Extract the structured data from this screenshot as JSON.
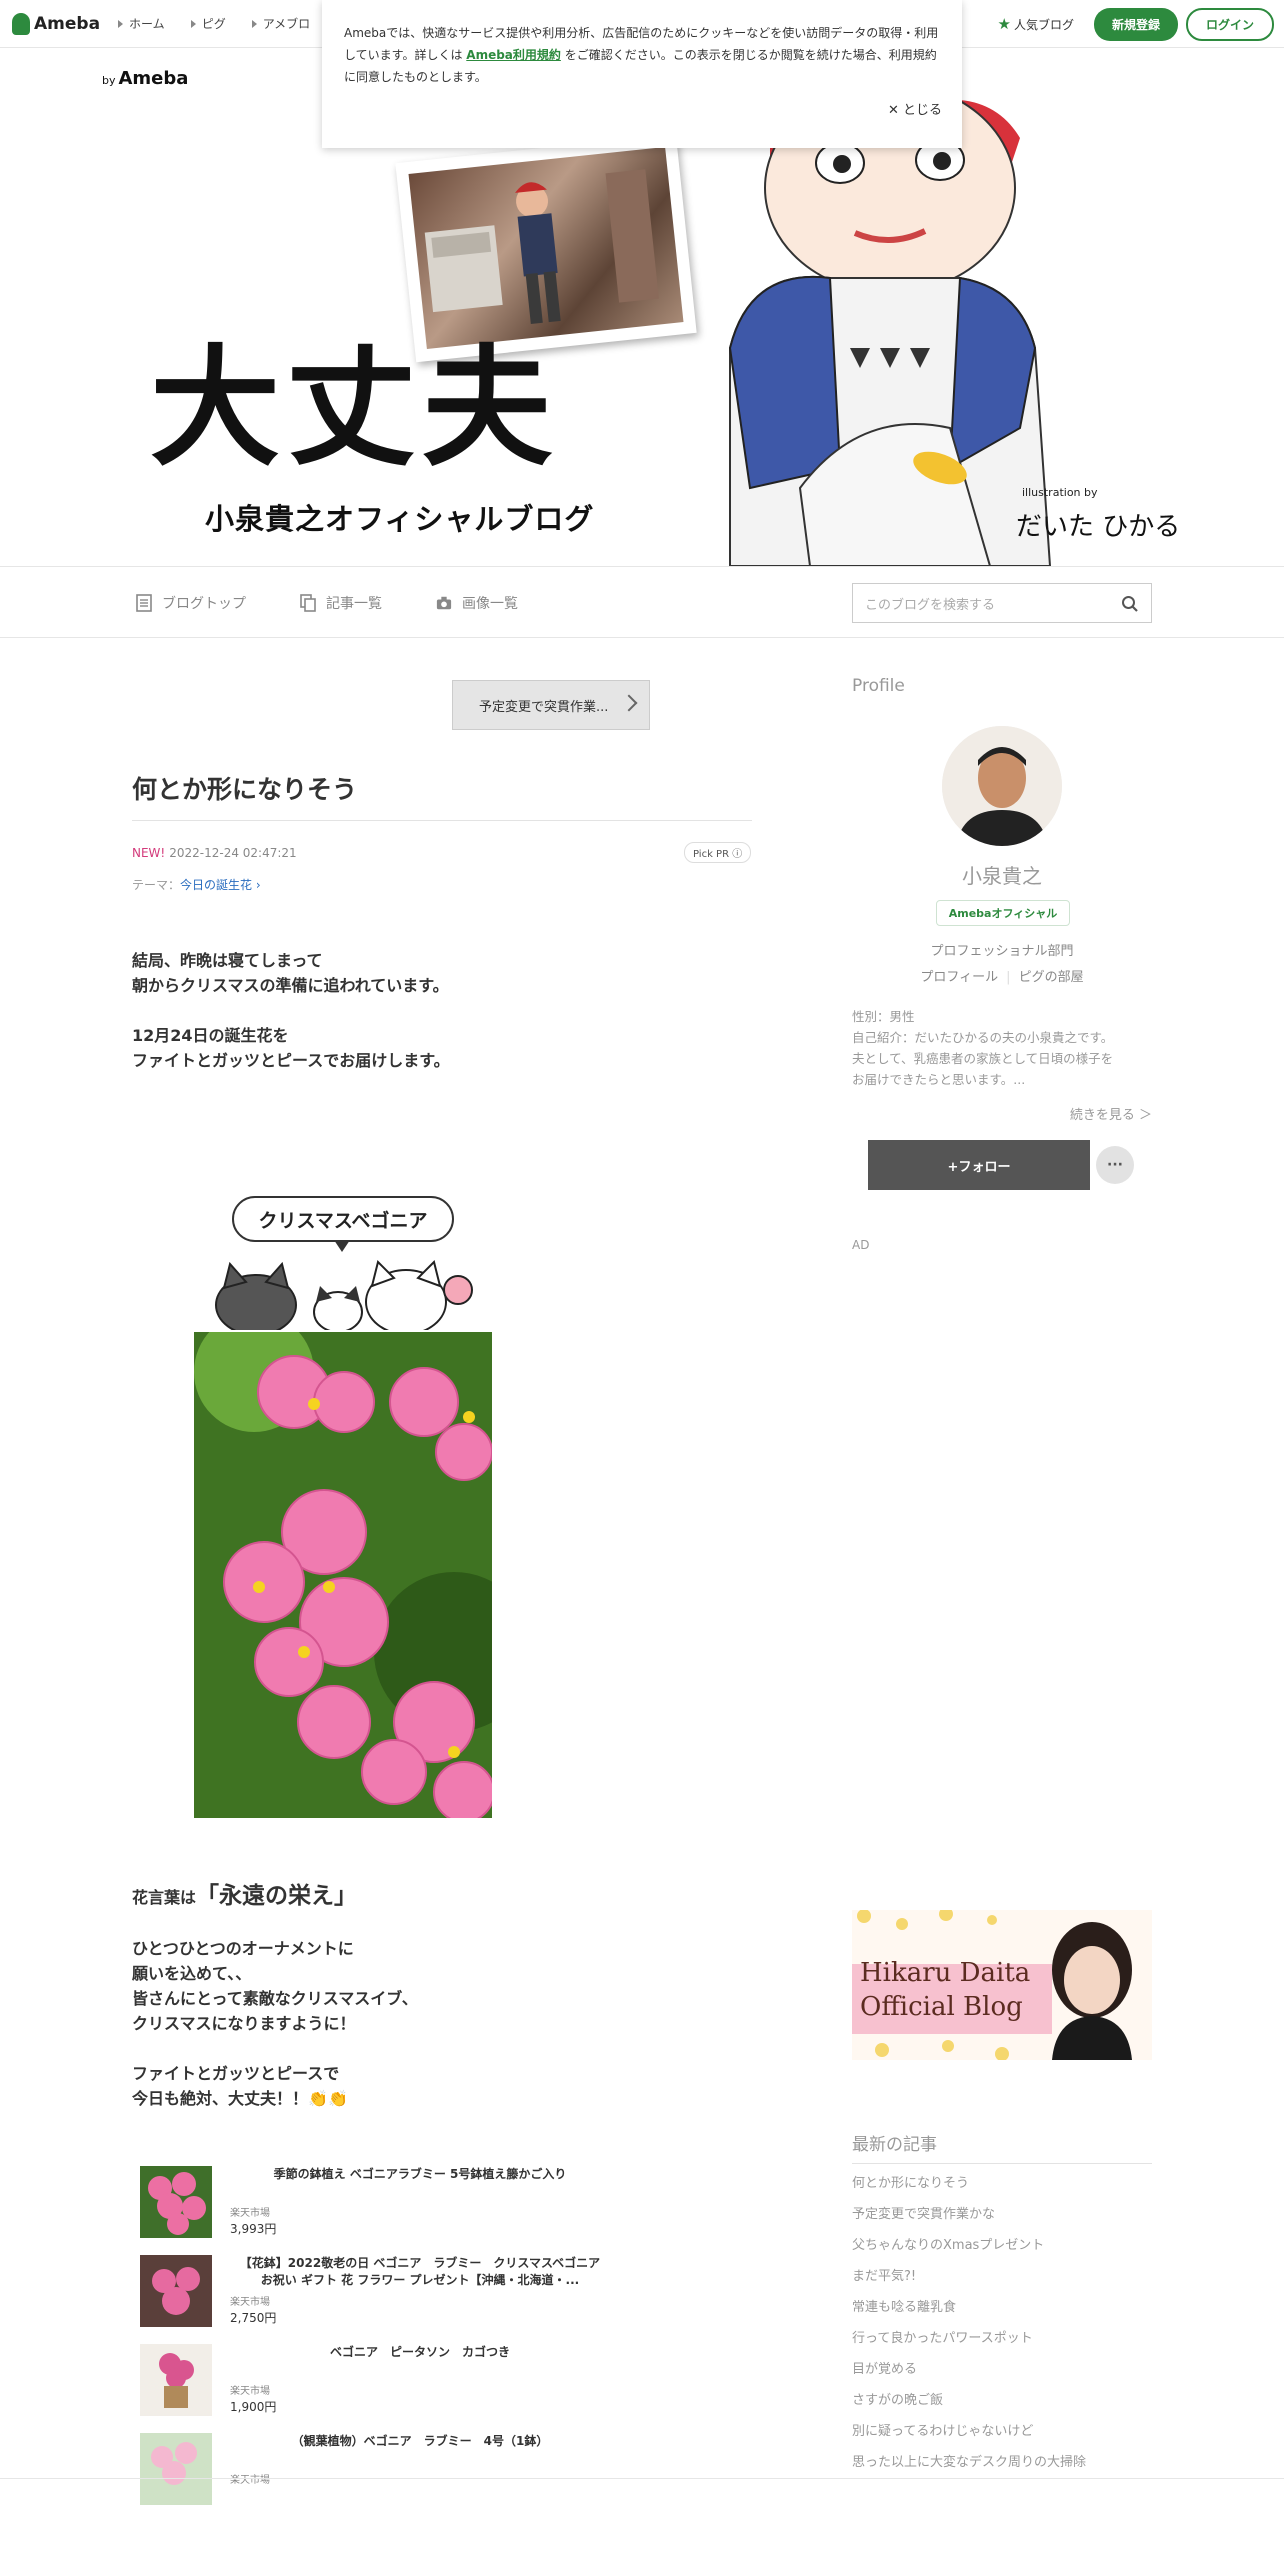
{
  "topnav": {
    "brand": "Ameba",
    "links": [
      "ホーム",
      "ピグ",
      "アメブロ"
    ],
    "popular": "人気ブログ",
    "signup": "新規登録",
    "login": "ログイン"
  },
  "cookie": {
    "text_before": "Amebaでは、快適なサービス提供や利用分析、広告配信のためにクッキーなどを使い訪問データの取得・利用しています。詳しくは",
    "link": "Ameba利用規約",
    "text_after": "をご確認ください。この表示を閉じるか閲覧を続けた場合、利用規約に同意したものとします。",
    "close": "とじる"
  },
  "header": {
    "by": "by",
    "by_brand": "Ameba",
    "title": "大丈夫",
    "subtitle": "小泉貴之オフィシャルブログ",
    "illustration_by": "illustration by",
    "illustrator": "だいた ひかる"
  },
  "blognav": {
    "items": [
      "ブログトップ",
      "記事一覧",
      "画像一覧"
    ],
    "search_placeholder": "このブログを検索する"
  },
  "entry": {
    "prev_link": "予定変更で突貫作業...",
    "title": "何とか形になりそう",
    "new": "NEW!",
    "date": "2022-12-24 02:47:21",
    "pick_pr": "Pick PR",
    "theme_label": "テーマ：",
    "theme": "今日の誕生花",
    "para1_line1": "結局、昨晩は寝てしまって",
    "para1_line2": "朝からクリスマスの準備に追われています。",
    "para2_line1": "12月24日の誕生花を",
    "para2_line2": "ファイトとガッツとピースでお届けします。",
    "bubble": "クリスマスベゴニア",
    "kotoba_prefix": "花言葉は",
    "kotoba": "「永遠の栄え」",
    "para3_line1": "ひとつひとつのオーナメントに",
    "para3_line2": "願いを込めて、、",
    "para3_line3": "皆さんにとって素敵なクリスマスイブ、",
    "para3_line4": "クリスマスになりますように！",
    "para4_line1": "ファイトとガッツとピースで",
    "para4_line2": "今日も絶対、大丈夫！！"
  },
  "products": [
    {
      "name": "季節の鉢植え ベゴニアラブミー 5号鉢植え籐かご入り",
      "shop": "楽天市場",
      "price": "3,993円"
    },
    {
      "name": "【花鉢】2022敬老の日 ベゴニア　ラブミー　クリスマスベゴニア　お祝い ギフト 花 フラワー プレゼント【沖縄・北海道・...",
      "shop": "楽天市場",
      "price": "2,750円"
    },
    {
      "name": "ベゴニア　ピータソン　カゴつき",
      "shop": "楽天市場",
      "price": "1,900円"
    },
    {
      "name": "（観葉植物）ベゴニア　ラブミー　4号（1鉢）",
      "shop": "楽天市場",
      "price": ""
    }
  ],
  "sidebar": {
    "profile_heading": "Profile",
    "name": "小泉貴之",
    "official": "Amebaオフィシャル",
    "dept": "プロフェッショナル部門",
    "link1": "プロフィール",
    "link2": "ピグの部屋",
    "bio_line1": "性別：男性",
    "bio_line2": "自己紹介：だいたひかるの夫の小泉貴之です。",
    "bio_line3": "夫として、乳癌患者の家族として日頃の様子を",
    "bio_line4": "お届けできたらと思います。...",
    "more": "続きを見る ＞",
    "follow": "+フォロー",
    "dots": "···",
    "ad": "AD",
    "banner_line1": "Hikaru Daita",
    "banner_line2": "Official Blog",
    "latest_heading": "最新の記事",
    "latest": [
      "何とか形になりそう",
      "予定変更で突貫作業かな",
      "父ちゃんなりのXmasプレゼント",
      "まだ平気?!",
      "常連も唸る離乳食",
      "行って良かったパワースポット",
      "目が覚める",
      "さすがの晩ご飯",
      "別に疑ってるわけじゃないけど",
      "思った以上に大変なデスク周りの大掃除"
    ]
  },
  "colors": {
    "brand_green": "#2d8a3e",
    "new_pink": "#d33b7b",
    "theme_blue": "#2a6dbf"
  }
}
